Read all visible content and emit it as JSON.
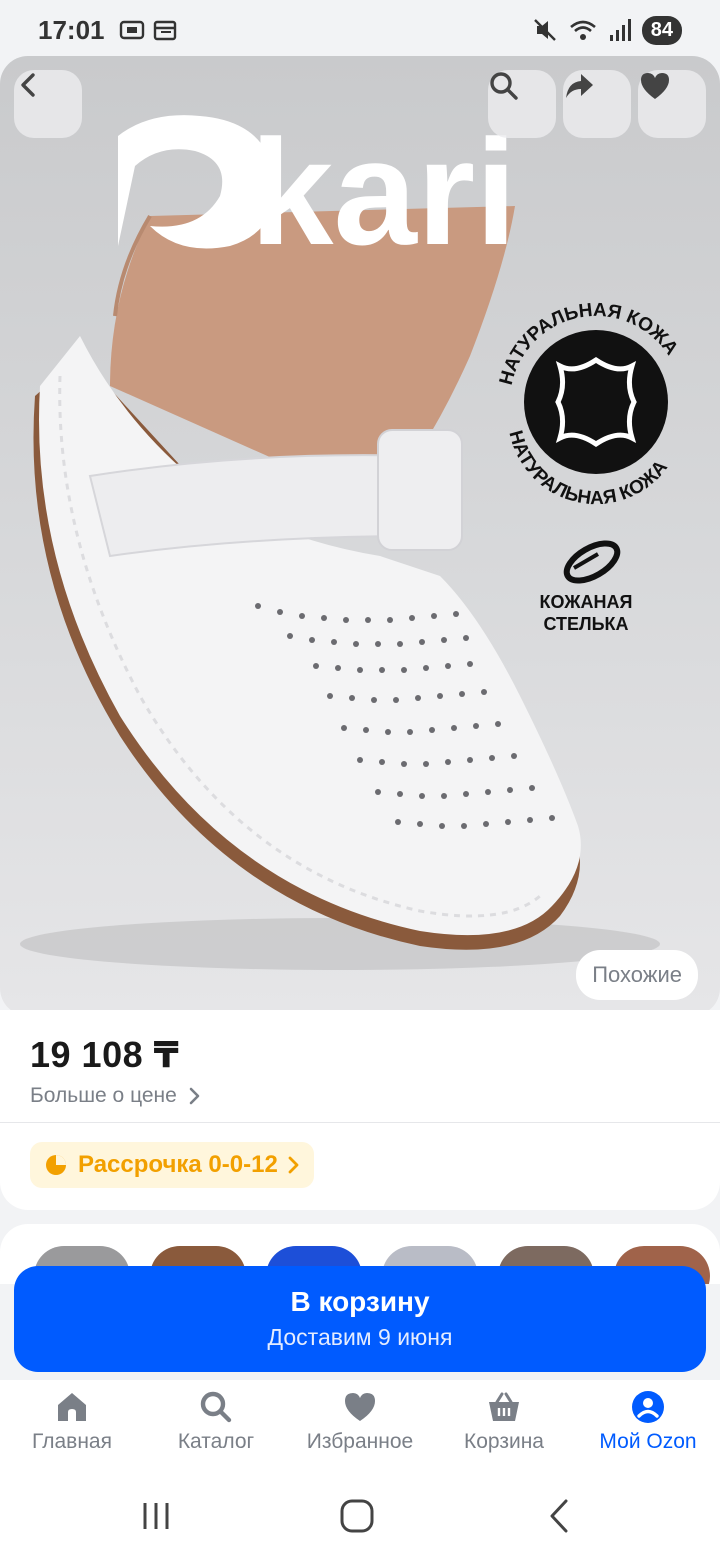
{
  "status_bar": {
    "time": "17:01",
    "battery": "84"
  },
  "hero": {
    "brand": "kari",
    "badge_natural_leather": "НАТУРАЛЬНАЯ КОЖА",
    "insole_line1": "КОЖАНАЯ",
    "insole_line2": "СТЕЛЬКА",
    "similar_label": "Похожие",
    "icons": [
      "back-icon",
      "search-icon",
      "share-icon",
      "heart-icon"
    ]
  },
  "product": {
    "price": "19 108 ₸",
    "price_more": "Больше о цене",
    "installment": "Рассрочка 0-0-12"
  },
  "cart": {
    "title": "В корзину",
    "subtitle": "Доставим 9 июня"
  },
  "nav": {
    "items": [
      {
        "label": "Главная",
        "icon": "home-icon"
      },
      {
        "label": "Каталог",
        "icon": "search-icon"
      },
      {
        "label": "Избранное",
        "icon": "heart-icon"
      },
      {
        "label": "Корзина",
        "icon": "basket-icon"
      },
      {
        "label": "Мой Ozon",
        "icon": "profile-icon",
        "active": true
      }
    ]
  },
  "colors": {
    "accent": "#005bff",
    "installment": "#f2a000"
  }
}
